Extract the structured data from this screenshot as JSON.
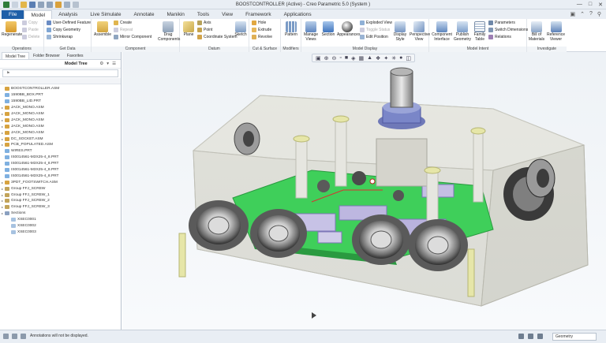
{
  "window": {
    "title": "BOOSTCONTROLLER (Active) - Creo Parametric 5.0 (System )"
  },
  "menu": {
    "tabs": [
      "File",
      "Model",
      "Analysis",
      "Live Simulate",
      "Annotate",
      "Manikin",
      "Tools",
      "View",
      "Framework",
      "Applications"
    ],
    "active": "Model"
  },
  "ribbon": {
    "operations": {
      "label": "Operations",
      "regenerate": "Regenerate",
      "copy": "Copy",
      "paste": "Paste",
      "delete": "Delete"
    },
    "get_data": {
      "label": "Get Data",
      "udf": "User-Defined Feature",
      "copy_geometry": "Copy Geometry",
      "shrinkwrap": "Shrinkwrap"
    },
    "component": {
      "label": "Component",
      "assemble": "Assemble",
      "create": "Create",
      "repeat": "Repeat",
      "mirror": "Mirror Component",
      "drag": "Drag Components"
    },
    "datum": {
      "label": "Datum",
      "plane": "Plane",
      "axis": "Axis",
      "point": "Point",
      "csys": "Coordinate System",
      "sketch": "Sketch"
    },
    "cut_surface": {
      "label": "Cut & Surface",
      "hole": "Hole",
      "extrude": "Extrude",
      "revolve": "Revolve"
    },
    "modifiers": {
      "label": "Modifiers",
      "pattern": "Pattern"
    },
    "model_display": {
      "label": "Model Display",
      "manage_views": "Manage Views",
      "section": "Section",
      "appearances": "Appearances",
      "exploded": "Exploded View",
      "toggle": "Toggle Status",
      "edit_position": "Edit Position",
      "display_style": "Display Style",
      "perspective": "Perspective View"
    },
    "model_intent": {
      "label": "Model Intent",
      "component_interface": "Component Interface",
      "publish": "Publish Geometry",
      "family": "Family Table",
      "parameters": "Parameters",
      "switch_dims": "Switch Dimensions",
      "relations": "Relations"
    },
    "investigate": {
      "label": "Investigate",
      "bom": "Bill of Materials",
      "reference_viewer": "Reference Viewer"
    }
  },
  "panel": {
    "tabs": [
      "Model Tree",
      "Folder Browser",
      "Favorites"
    ],
    "header": "Model Tree",
    "search_placeholder": "",
    "column": "",
    "root": "BOOSTCONTROLLER.ASM",
    "items": [
      "1590BB_BOX.PRT",
      "1590BB_LID.PRT",
      "JACK_MONO.ASM",
      "JACK_MONO.ASM",
      "JACK_MONO.ASM",
      "JACK_MONO.ASM",
      "JACK_MONO.ASM",
      "DC_SOCKET.ASM",
      "PCB_POPULATED.ASM",
      "WIRES.PRT",
      "IS0014561-M3X25-4_8.PRT",
      "IS0014561-M3X25-4_8.PRT",
      "IS0014561-M3X25-4_8.PRT",
      "IS0014561-M3X25-4_8.PRT",
      "3PDT_FOOTSWITCH.ASM",
      "Group FFJ_SCREW",
      "Group FFJ_SCREW_1",
      "Group FFJ_SCREW_2",
      "Group FFJ_SCREW_3",
      "Sections",
      "XSEC0001",
      "XSEC0002",
      "XSEC0003"
    ]
  },
  "status": {
    "message": "Annotations will not be displayed.",
    "filter": "Geometry"
  },
  "colors": {
    "file_tab": "#1f5fa8",
    "pcb": "#3fcf5a",
    "enclosure": "#dcdccf",
    "standoff": "#e6e6a8"
  }
}
